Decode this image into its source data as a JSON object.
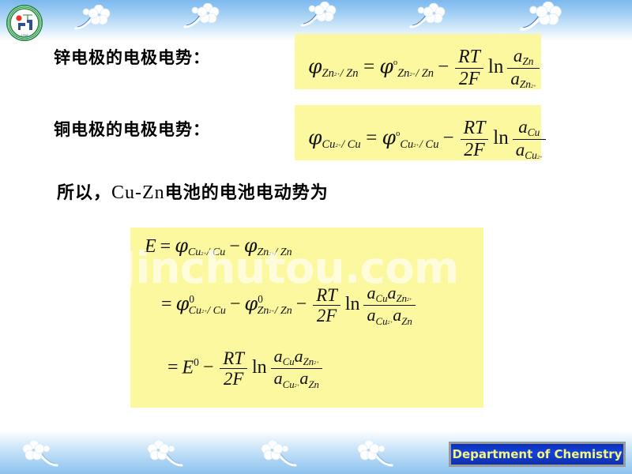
{
  "slide": {
    "background_color": "#ffffff",
    "band_color_top": "#7cb8ee",
    "band_color_bottom": "#8cc3ef",
    "formula_box_color": "#fbf8a0"
  },
  "logo": {
    "name": "university-seal-logo",
    "ring_color": "#1f8a3c",
    "mark_color": "#2b4f9e",
    "dot_color": "#e8322a",
    "year": "1958"
  },
  "labels": {
    "zinc_electrode": "锌电极的电极电势：",
    "copper_electrode": "铜电极的电极电势："
  },
  "statement": {
    "prefix": "所以，",
    "middle": "Cu-Zn",
    "suffix": "电池的电池电动势为"
  },
  "formula_zinc": {
    "lhs_symbol": "φ",
    "lhs_sub": "Zn",
    "lhs_sub_charge": "2+",
    "lhs_sub_tail": "/ Zn",
    "equals": "=",
    "rhs_symbol": "φ",
    "rhs_sup": "o",
    "rhs_sub": "Zn",
    "rhs_sub_charge": "2+",
    "rhs_sub_tail": "/ Zn",
    "minus": "−",
    "frac_num": "RT",
    "frac_den": "2F",
    "ln": "ln",
    "log_num_a": "a",
    "log_num_sub": "Zn",
    "log_den_a": "a",
    "log_den_sub": "Zn",
    "log_den_charge": "2+"
  },
  "formula_copper": {
    "lhs_symbol": "φ",
    "lhs_sub": "Cu",
    "lhs_sub_charge": "2+",
    "lhs_sub_tail": "/ Cu",
    "equals": "=",
    "rhs_symbol": "φ",
    "rhs_sup": "o",
    "rhs_sub": "Cu",
    "rhs_sub_charge": "2+",
    "rhs_sub_tail": "/ Cu",
    "minus": "−",
    "frac_num": "RT",
    "frac_den": "2F",
    "ln": "ln",
    "log_num_a": "a",
    "log_num_sub": "Cu",
    "log_den_a": "a",
    "log_den_sub": "Cu",
    "log_den_charge": "2+"
  },
  "formula_emf": {
    "line1": {
      "lhs": "E",
      "equals": "=",
      "phi1": "φ",
      "phi1_sub": "Cu",
      "phi1_charge": "2+",
      "phi1_tail": "/ Cu",
      "minus": "−",
      "phi2": "φ",
      "phi2_sub": "Zn",
      "phi2_charge": "2+",
      "phi2_tail": "/ Zn"
    },
    "line2": {
      "equals": "=",
      "phi1": "φ",
      "phi1_sup": "0",
      "phi1_sub": "Cu",
      "phi1_charge": "2+",
      "phi1_tail": "/ Cu",
      "minus1": "−",
      "phi2": "φ",
      "phi2_sup": "0",
      "phi2_sub": "Zn",
      "phi2_charge": "2+",
      "phi2_tail": "/ Zn",
      "minus2": "−",
      "frac_num": "RT",
      "frac_den": "2F",
      "ln": "ln",
      "log_num_a1": "a",
      "log_num_sub1": "Cu",
      "log_num_a2": "a",
      "log_num_sub2": "Zn",
      "log_num_charge2": "2+",
      "log_den_a1": "a",
      "log_den_sub1": "Cu",
      "log_den_charge1": "2+",
      "log_den_a2": "a",
      "log_den_sub2": "Zn"
    },
    "line3": {
      "equals": "=",
      "lhs": "E",
      "lhs_sup": "0",
      "minus": "−",
      "frac_num": "RT",
      "frac_den": "2F",
      "ln": "ln",
      "log_num_a1": "a",
      "log_num_sub1": "Cu",
      "log_num_a2": "a",
      "log_num_sub2": "Zn",
      "log_num_charge2": "2+",
      "log_den_a1": "a",
      "log_den_sub1": "Cu",
      "log_den_charge1": "2+",
      "log_den_a2": "a",
      "log_den_sub2": "Zn"
    }
  },
  "watermark": {
    "text": "Jinchutou.com",
    "color": "#ffffff"
  },
  "footer": {
    "department_label": "Department of Chemistry",
    "text_color": "#f5f77a",
    "background_color": "#1542e0"
  }
}
